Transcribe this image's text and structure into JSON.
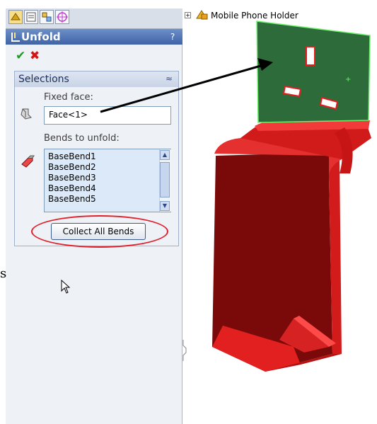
{
  "tree": {
    "expand_symbol": "+",
    "part_name": "Mobile Phone Holder"
  },
  "panel": {
    "title": "Unfold",
    "help": "?",
    "ok_symbol": "✔",
    "cancel_symbol": "✖",
    "group_title": "Selections",
    "collapse_symbol": "≈",
    "fixed_face_label": "Fixed face:",
    "fixed_face_value": "Face<1>",
    "bends_label": "Bends to unfold:",
    "bends": [
      "BaseBend1",
      "BaseBend2",
      "BaseBend3",
      "BaseBend4",
      "BaseBend5"
    ],
    "collect_label": "Collect All Bends"
  },
  "margin_text": "s",
  "colors": {
    "part_red": "#e41e1e",
    "face_green": "#2e6b3a",
    "highlight_green": "#6cf06c",
    "annotation_red": "#e0202a"
  },
  "icons": [
    "feature-manager-icon",
    "property-manager-icon",
    "configuration-manager-icon",
    "dim-xpert-icon",
    "part-icon",
    "face-select-icon",
    "bend-select-icon",
    "mouse-pointer-icon",
    "arrow-annotation"
  ]
}
